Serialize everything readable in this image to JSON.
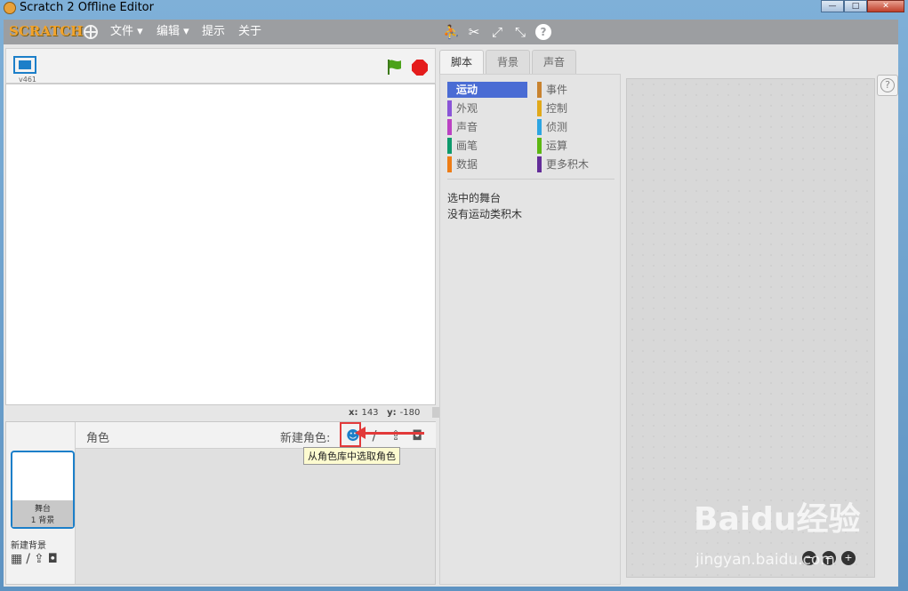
{
  "window": {
    "title": "Scratch 2 Offline Editor",
    "minimize": "—",
    "maximize": "□",
    "close": "✕"
  },
  "menubar": {
    "logo": "SCRATCH",
    "menus": [
      "文件 ▾",
      "编辑 ▾",
      "提示",
      "关于"
    ],
    "tools": [
      "duplicate-icon",
      "delete-icon",
      "grow-icon",
      "shrink-icon",
      "help-icon"
    ]
  },
  "stage": {
    "version": "v461",
    "coords": {
      "x_label": "x:",
      "x": "143",
      "y_label": "y:",
      "y": "-180"
    }
  },
  "sprites": {
    "label": "角色",
    "new_sprite_label": "新建角色:",
    "tooltip": "从角色库中选取角色",
    "stage_thumb": {
      "name": "舞台",
      "detail": "1 背景"
    },
    "new_backdrop_label": "新建背景"
  },
  "tabs": [
    "脚本",
    "背景",
    "声音"
  ],
  "palette": {
    "categories": [
      {
        "label": "运动",
        "color": "#4a6cd4",
        "active": true
      },
      {
        "label": "外观",
        "color": "#8a55d7"
      },
      {
        "label": "声音",
        "color": "#bb42c3"
      },
      {
        "label": "画笔",
        "color": "#0e9a6c"
      },
      {
        "label": "数据",
        "color": "#ee7d16"
      },
      {
        "label": "事件",
        "color": "#c88330"
      },
      {
        "label": "控制",
        "color": "#e1a91a"
      },
      {
        "label": "侦测",
        "color": "#2ca5e2"
      },
      {
        "label": "运算",
        "color": "#5cb712"
      },
      {
        "label": "更多积木",
        "color": "#632d99"
      }
    ],
    "selected_label": "选中的舞台",
    "empty_message": "没有运动类积木"
  },
  "scripts": {
    "help": "?",
    "zoom": [
      "−",
      "=",
      "+"
    ]
  },
  "watermark": {
    "brand": "Baidu经验",
    "url": "jingyan.baidu.com"
  }
}
